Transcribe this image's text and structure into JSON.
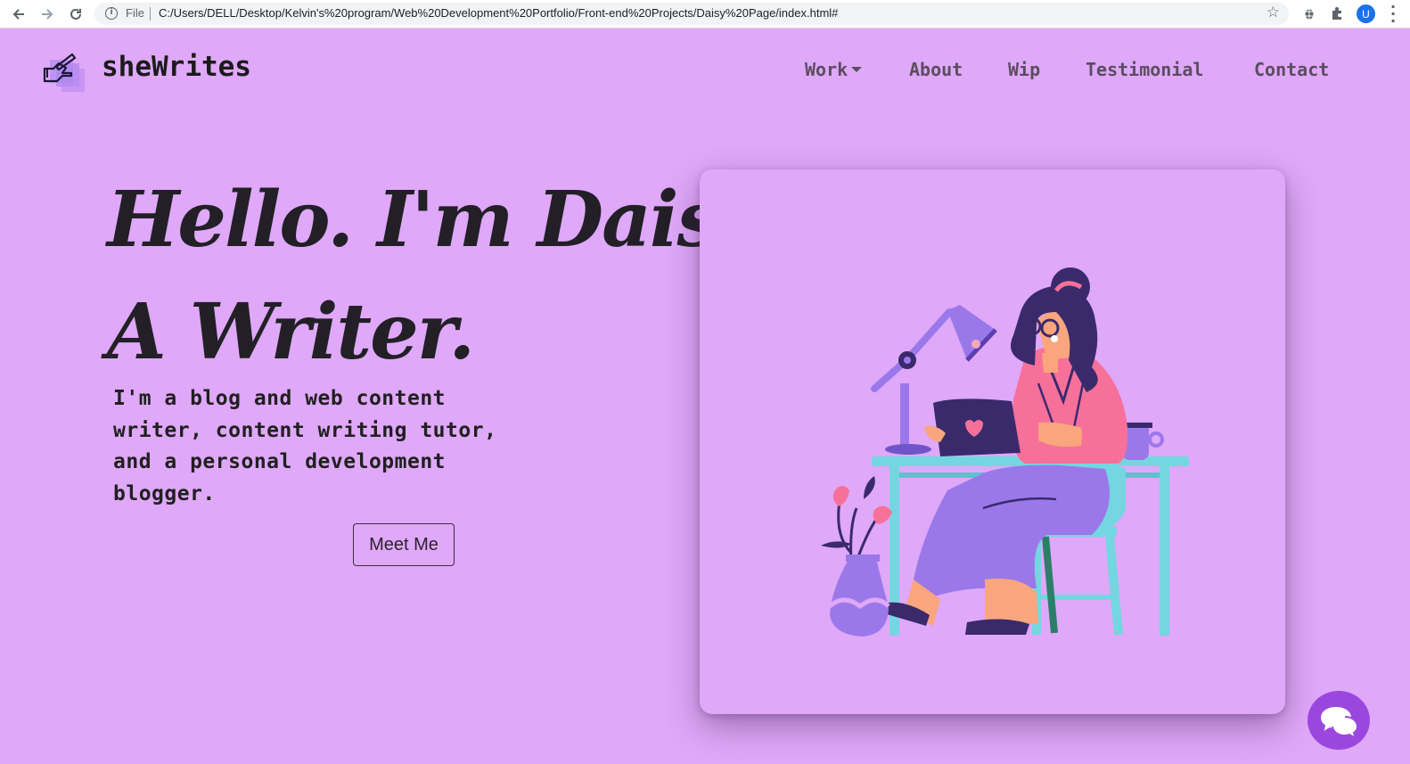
{
  "browser": {
    "scheme_label": "File",
    "url": "C:/Users/DELL/Desktop/Kelvin's%20program/Web%20Development%20Portfolio/Front-end%20Projects/Daisy%20Page/index.html#",
    "profile_initial": "U"
  },
  "header": {
    "brand": "sheWrites",
    "nav": [
      "Work",
      "About",
      "Wip",
      "Testimonial",
      "Contact"
    ]
  },
  "hero": {
    "title_line1": "Hello. I'm Daisy.",
    "title_line2": "A Writer.",
    "description": "I'm a blog and web content writer, content writing tutor, and a personal development blogger.",
    "cta_label": "Meet Me"
  },
  "colors": {
    "page_background": "#dfa8f8",
    "illustration_purple": "#9b78ea",
    "illustration_pink": "#f7709a",
    "illustration_teal": "#74d6e0",
    "chat_button": "#9b47df"
  },
  "icons": {
    "logo": "writing-hand-icon",
    "chat": "chat-bubbles-icon"
  }
}
